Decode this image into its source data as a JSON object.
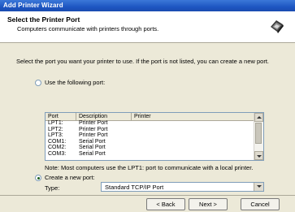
{
  "window": {
    "title": "Add Printer Wizard"
  },
  "header": {
    "title": "Select the Printer Port",
    "subtitle": "Computers communicate with printers through ports."
  },
  "intro_text": "Select the port you want your printer to use.  If the port is not listed, you can create a new port.",
  "use_existing": {
    "label": "Use the following port:",
    "selected": false
  },
  "port_list": {
    "columns": [
      "Port",
      "Description",
      "Printer"
    ],
    "rows": [
      {
        "port": "LPT1:",
        "description": "Printer Port",
        "printer": ""
      },
      {
        "port": "LPT2:",
        "description": "Printer Port",
        "printer": ""
      },
      {
        "port": "LPT3:",
        "description": "Printer Port",
        "printer": ""
      },
      {
        "port": "COM1:",
        "description": "Serial Port",
        "printer": ""
      },
      {
        "port": "COM2:",
        "description": "Serial Port",
        "printer": ""
      },
      {
        "port": "COM3:",
        "description": "Serial Port",
        "printer": ""
      }
    ]
  },
  "note": "Note: Most computers use the LPT1: port to communicate with a local printer.",
  "create_new": {
    "label": "Create a new port:",
    "selected": true
  },
  "type": {
    "label": "Type:",
    "value": "Standard TCP/IP Port"
  },
  "buttons": {
    "back": "< Back",
    "next": "Next >",
    "cancel": "Cancel"
  },
  "icons": {
    "header": "printer-icon"
  }
}
